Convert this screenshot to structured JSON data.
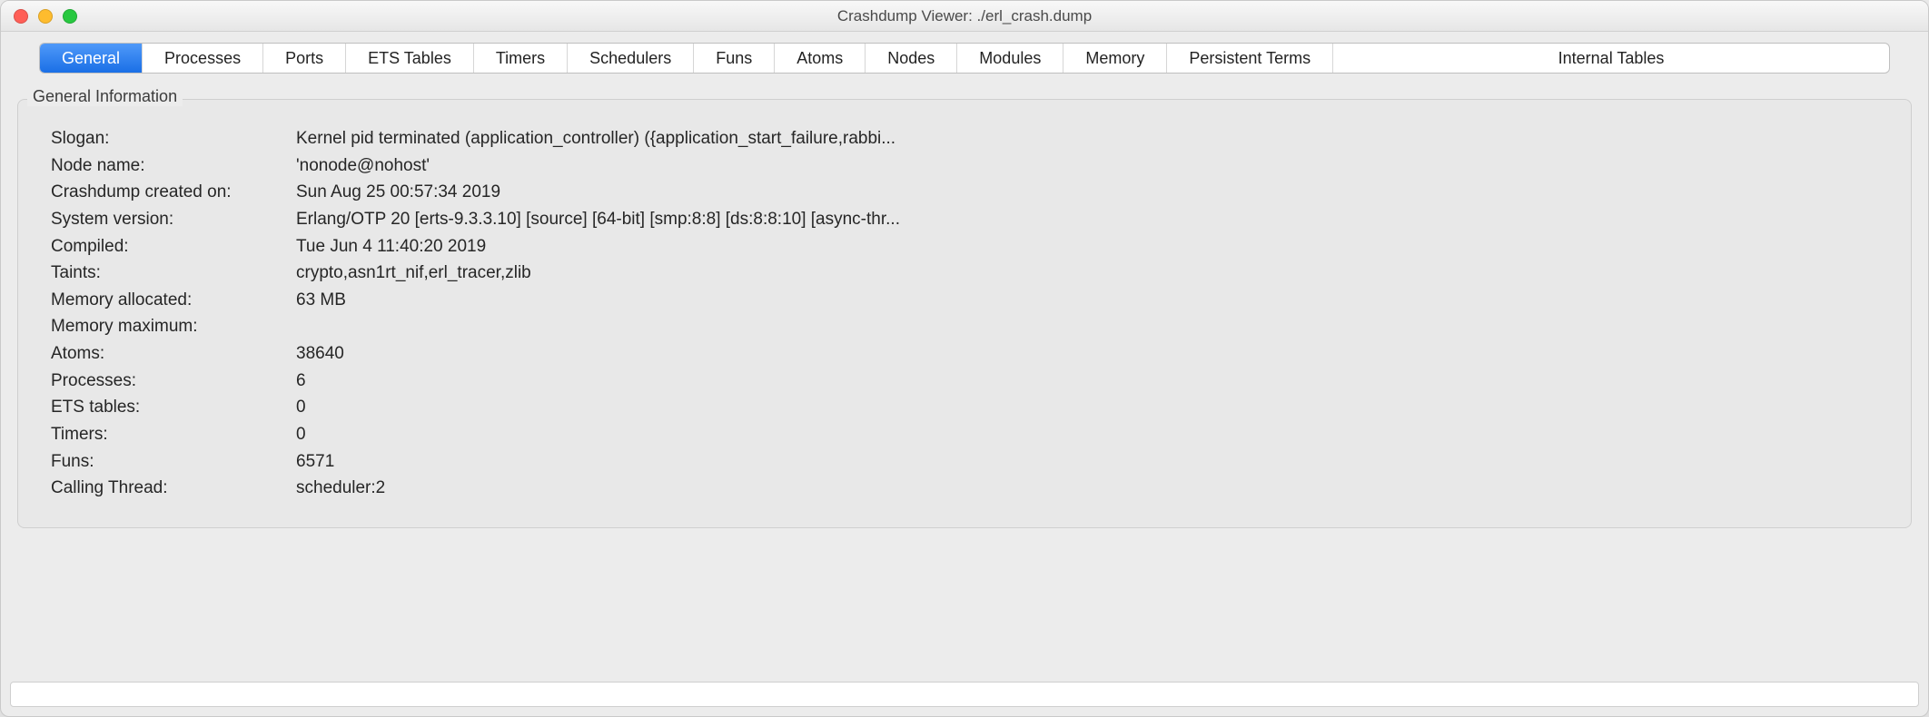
{
  "window": {
    "title": "Crashdump Viewer: ./erl_crash.dump"
  },
  "tabs": [
    {
      "label": "General",
      "active": true
    },
    {
      "label": "Processes",
      "active": false
    },
    {
      "label": "Ports",
      "active": false
    },
    {
      "label": "ETS Tables",
      "active": false
    },
    {
      "label": "Timers",
      "active": false
    },
    {
      "label": "Schedulers",
      "active": false
    },
    {
      "label": "Funs",
      "active": false
    },
    {
      "label": "Atoms",
      "active": false
    },
    {
      "label": "Nodes",
      "active": false
    },
    {
      "label": "Modules",
      "active": false
    },
    {
      "label": "Memory",
      "active": false
    },
    {
      "label": "Persistent Terms",
      "active": false
    },
    {
      "label": "Internal Tables",
      "active": false
    }
  ],
  "group": {
    "title": "General Information",
    "rows": [
      {
        "label": "Slogan:",
        "value": "Kernel pid terminated (application_controller) ({application_start_failure,rabbi..."
      },
      {
        "label": "Node name:",
        "value": "'nonode@nohost'"
      },
      {
        "label": "Crashdump created on:",
        "value": "Sun Aug 25 00:57:34 2019"
      },
      {
        "label": "System version:",
        "value": "Erlang/OTP 20 [erts-9.3.3.10] [source] [64-bit] [smp:8:8] [ds:8:8:10] [async-thr..."
      },
      {
        "label": "Compiled:",
        "value": "Tue Jun  4 11:40:20 2019"
      },
      {
        "label": "Taints:",
        "value": "crypto,asn1rt_nif,erl_tracer,zlib"
      },
      {
        "label": "Memory allocated:",
        "value": "63 MB"
      },
      {
        "label": "Memory maximum:",
        "value": ""
      },
      {
        "label": "Atoms:",
        "value": "38640"
      },
      {
        "label": "Processes:",
        "value": "6"
      },
      {
        "label": "ETS tables:",
        "value": "0"
      },
      {
        "label": "Timers:",
        "value": "0"
      },
      {
        "label": "Funs:",
        "value": "6571"
      },
      {
        "label": "Calling Thread:",
        "value": "scheduler:2"
      }
    ]
  },
  "statusbar": {
    "text": ""
  }
}
